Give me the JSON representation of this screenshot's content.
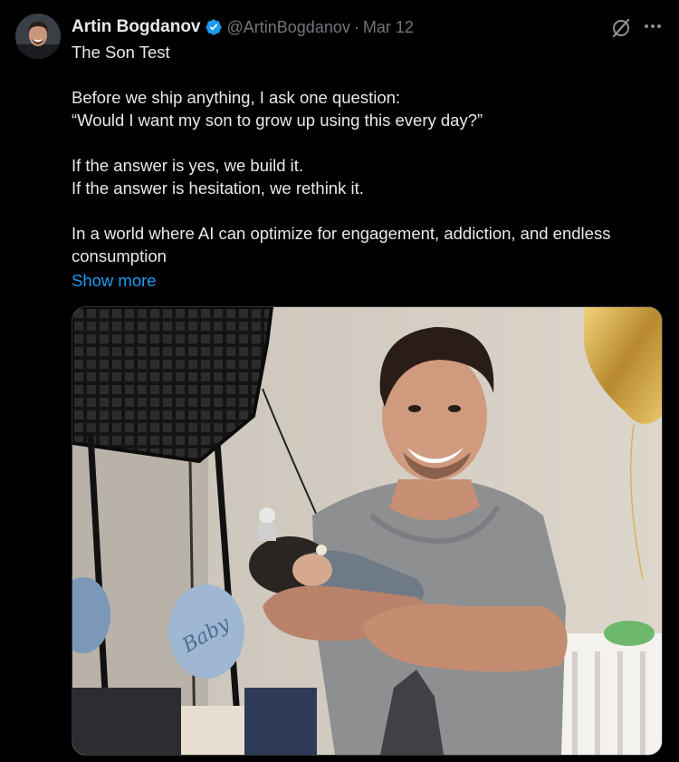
{
  "author": {
    "name": "Artin Bogdanov",
    "handle": "@ArtinBogdanov",
    "separator": "·",
    "date": "Mar 12",
    "verified": true,
    "verified_color": "#1d9bf0"
  },
  "post": {
    "lines": [
      "The Son Test",
      "",
      "Before we ship anything, I ask one question:",
      "“Would I want my son to grow up using this every day?”",
      "",
      "If the answer is yes, we build it.",
      "If the answer is hesitation, we rethink it.",
      "",
      "In a world where AI can optimize for engagement, addiction, and endless",
      "consumption"
    ],
    "show_more": "Show more"
  },
  "media": {
    "balloon_text": "Baby"
  },
  "icons": {
    "grok": "grok-icon",
    "more": "more-icon",
    "verified": "verified-badge-icon"
  },
  "colors": {
    "background": "#000000",
    "text": "#e7e9ea",
    "secondary": "#71767b",
    "link": "#1d9bf0"
  }
}
